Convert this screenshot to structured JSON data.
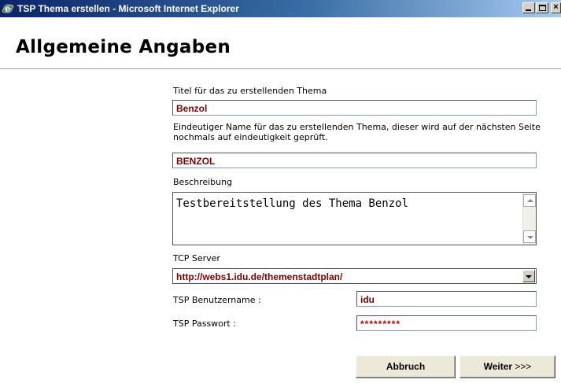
{
  "window": {
    "title": "TSP Thema erstellen - Microsoft Internet Explorer"
  },
  "page": {
    "heading": "Allgemeine Angaben"
  },
  "form": {
    "title_label": "Titel für das zu erstellenden Thema",
    "title_value": "Benzol",
    "unique_name_label": "Eindeutiger Name für das zu erstellenden Thema, dieser wird auf der nächsten Seite nochmals auf eindeutigkeit geprüft.",
    "unique_name_value": "BENZOL",
    "description_label": "Beschreibung",
    "description_value": "Testbereitstellung des Thema Benzol",
    "server_label": "TCP Server",
    "server_value": "http://webs1.idu.de/themenstadtplan/",
    "username_label": "TSP Benutzername :",
    "username_value": "idu",
    "password_label": "TSP Passwort :",
    "password_value": "*********"
  },
  "buttons": {
    "cancel": "Abbruch",
    "next": "Weiter",
    "next_arrows": ">>>"
  }
}
